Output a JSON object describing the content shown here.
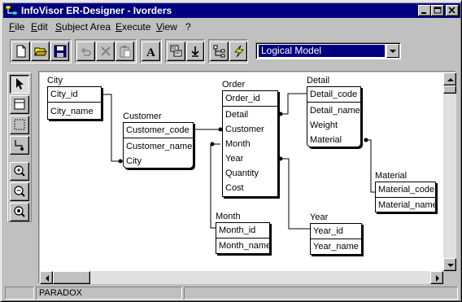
{
  "window": {
    "title": "InfoVisor ER-Designer - Ivorders"
  },
  "menu": [
    "File",
    "Edit",
    "Subject Area",
    "Execute",
    "View",
    "?"
  ],
  "toolbar": {
    "icons": [
      "new-file-icon",
      "open-folder-icon",
      "save-disk-icon",
      "undo-icon",
      "delete-icon",
      "paste-icon",
      "text-font-icon",
      "copy-down-icon",
      "tree-icon",
      "lightning-icon"
    ],
    "model_select": "Logical Model"
  },
  "palette": [
    "pointer-icon",
    "entity-icon",
    "subject-area-icon",
    "relationship-icon",
    "zoom-in-icon",
    "zoom-out-icon",
    "zoom-fit-icon"
  ],
  "entities": [
    {
      "name": "City",
      "keys": [
        "City_id"
      ],
      "attrs": [
        "City_name"
      ]
    },
    {
      "name": "Customer",
      "keys": [
        "Customer_code"
      ],
      "attrs": [
        "Customer_name",
        "City"
      ]
    },
    {
      "name": "Order",
      "keys": [
        "Order_id"
      ],
      "attrs": [
        "Detail",
        "Customer",
        "Month",
        "Year",
        "Quantity",
        "Cost"
      ]
    },
    {
      "name": "Detail",
      "keys": [
        "Detail_code"
      ],
      "attrs": [
        "Detail_name",
        "Weight",
        "Material"
      ]
    },
    {
      "name": "Material",
      "keys": [
        "Material_code"
      ],
      "attrs": [
        "Material_name"
      ]
    },
    {
      "name": "Month",
      "keys": [
        "Month_id"
      ],
      "attrs": [
        "Month_name"
      ]
    },
    {
      "name": "Year",
      "keys": [
        "Year_id"
      ],
      "attrs": [
        "Year_name"
      ]
    }
  ],
  "status": {
    "database": "PARADOX"
  },
  "colors": {
    "titlebar": "#000080",
    "face": "#c0c0c0"
  }
}
